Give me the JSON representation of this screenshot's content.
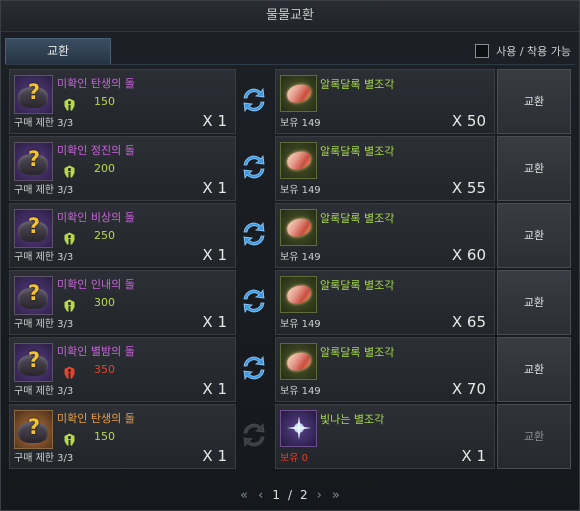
{
  "window": {
    "title": "물물교환"
  },
  "tab": {
    "label": "교환"
  },
  "options": {
    "equip_label": "사용 / 착용 가능"
  },
  "rows": [
    {
      "item": {
        "name": "미확인 탄생의 돌",
        "power": "150",
        "power_color": "green",
        "grade": "purple"
      },
      "limit": "구매 제한 3/3",
      "cost_qty": "X 1",
      "swap_active": true,
      "reward": {
        "name": "알록달록 별조각",
        "owned": "보유 149",
        "owned_color": "normal",
        "qty": "X 50",
        "icon": "shard-icon"
      },
      "button": "교환",
      "button_enabled": true
    },
    {
      "item": {
        "name": "미확인 정진의 돌",
        "power": "200",
        "power_color": "green",
        "grade": "purple"
      },
      "limit": "구매 제한 3/3",
      "cost_qty": "X 1",
      "swap_active": true,
      "reward": {
        "name": "알록달록 별조각",
        "owned": "보유 149",
        "owned_color": "normal",
        "qty": "X 55",
        "icon": "shard-icon"
      },
      "button": "교환",
      "button_enabled": true
    },
    {
      "item": {
        "name": "미확인 비상의 돌",
        "power": "250",
        "power_color": "green",
        "grade": "purple"
      },
      "limit": "구매 제한 3/3",
      "cost_qty": "X 1",
      "swap_active": true,
      "reward": {
        "name": "알록달록 별조각",
        "owned": "보유 149",
        "owned_color": "normal",
        "qty": "X 60",
        "icon": "shard-icon"
      },
      "button": "교환",
      "button_enabled": true
    },
    {
      "item": {
        "name": "미확인 인내의 돌",
        "power": "300",
        "power_color": "green",
        "grade": "purple"
      },
      "limit": "구매 제한 3/3",
      "cost_qty": "X 1",
      "swap_active": true,
      "reward": {
        "name": "알록달록 별조각",
        "owned": "보유 149",
        "owned_color": "normal",
        "qty": "X 65",
        "icon": "shard-icon"
      },
      "button": "교환",
      "button_enabled": true
    },
    {
      "item": {
        "name": "미확인 별밤의 돌",
        "power": "350",
        "power_color": "red",
        "grade": "purple"
      },
      "limit": "구매 제한 3/3",
      "cost_qty": "X 1",
      "swap_active": true,
      "reward": {
        "name": "알록달록 별조각",
        "owned": "보유 149",
        "owned_color": "normal",
        "qty": "X 70",
        "icon": "shard-icon"
      },
      "button": "교환",
      "button_enabled": true
    },
    {
      "item": {
        "name": "미확인 탄생의 돌",
        "power": "150",
        "power_color": "green",
        "grade": "orange"
      },
      "limit": "구매 제한 3/3",
      "cost_qty": "X 1",
      "swap_active": false,
      "reward": {
        "name": "빛나는 별조각",
        "owned": "보유 0",
        "owned_color": "red",
        "qty": "X 1",
        "icon": "sparkle-star-icon"
      },
      "button": "교환",
      "button_enabled": false
    }
  ],
  "pagination": {
    "current": "1",
    "separator": "/",
    "total": "2"
  },
  "colors": {
    "purple_name": "#c765d9",
    "orange_name": "#e8a048",
    "power_green": "#b7d94a",
    "power_red": "#e2462e",
    "reward_name": "#a6d84b"
  }
}
